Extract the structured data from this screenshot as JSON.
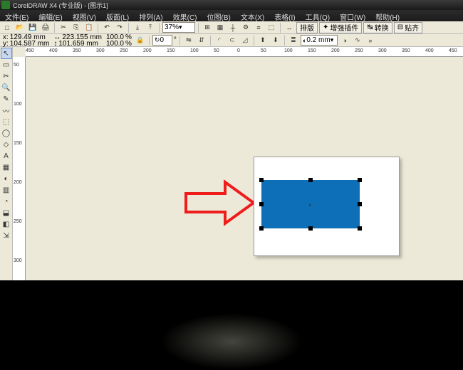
{
  "titlebar": {
    "title": "CorelDRAW X4 (专业版) - [图示1]"
  },
  "menubar": [
    "文件(E)",
    "编辑(E)",
    "视图(V)",
    "版面(L)",
    "排列(A)",
    "效果(C)",
    "位图(B)",
    "文本(X)",
    "表格(I)",
    "工具(Q)",
    "窗口(W)",
    "帮助(H)"
  ],
  "toolbar1": {
    "zoom": "37%",
    "buttons": [
      "排版",
      "增强插件",
      "转换",
      "贴齐"
    ]
  },
  "toolbar2": {
    "x_label": "x:",
    "y_label": "y:",
    "x": "129.49 mm",
    "y": "104.587 mm",
    "w_label": "↔",
    "h_label": "↕",
    "w": "223.155 mm",
    "h": "101.659 mm",
    "scale_x": "100.0",
    "scale_y": "100.0",
    "pct": "%",
    "rot": "0",
    "rot_deg": "°",
    "outline": "0.2 mm"
  },
  "ruler_h": [
    "450",
    "400",
    "350",
    "300",
    "250",
    "200",
    "150",
    "100",
    "50",
    "0",
    "50",
    "100",
    "150",
    "200",
    "250",
    "300",
    "350",
    "400",
    "450"
  ],
  "ruler_v": [
    "50",
    "100",
    "150",
    "200",
    "250",
    "300"
  ],
  "tools": [
    "↖",
    "▭",
    "✂",
    "🔍",
    "✎",
    "〰",
    "⬚",
    "◯",
    "◇",
    "A",
    "▦",
    "◐",
    "▥",
    "◔",
    "⬓",
    "◧",
    "⇲"
  ]
}
